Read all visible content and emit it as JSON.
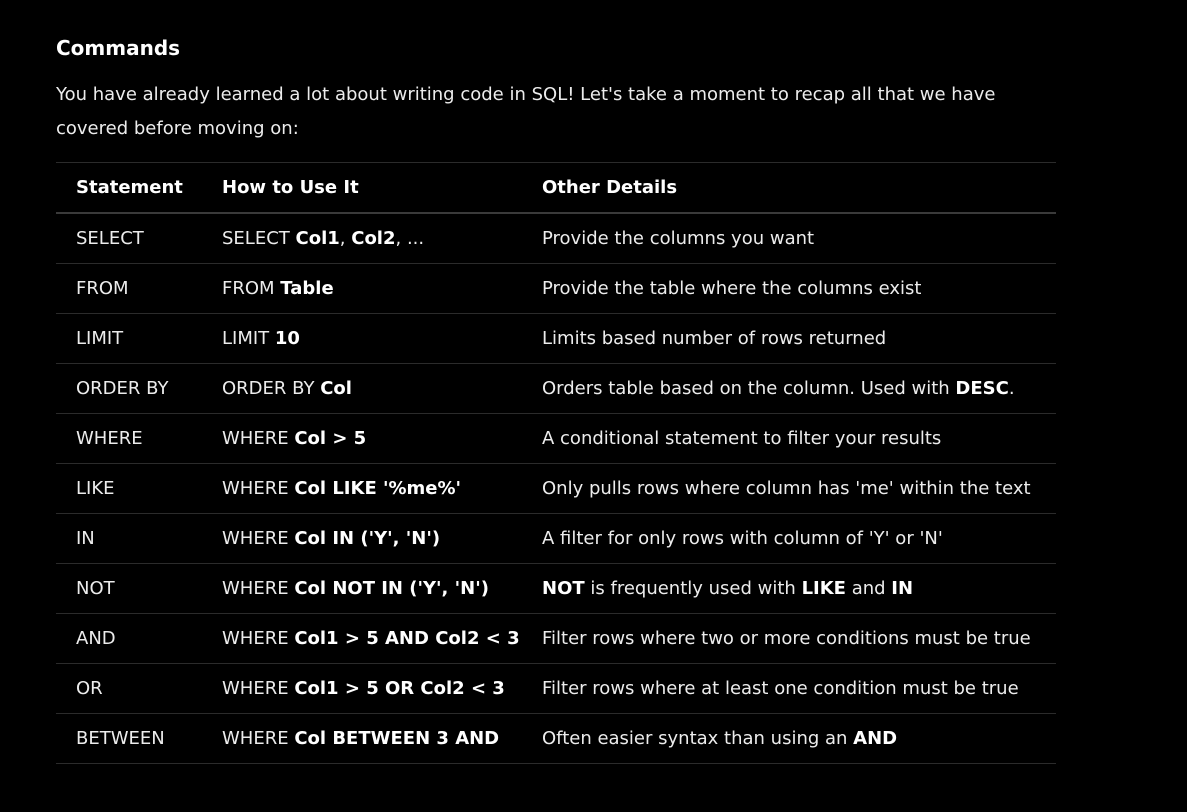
{
  "heading": "Commands",
  "intro": "You have already learned a lot about writing code in SQL! Let's take a moment to recap all that we have covered before moving on:",
  "table": {
    "headers": [
      "Statement",
      "How to Use It",
      "Other Details"
    ],
    "rows": [
      {
        "statement": "SELECT",
        "usage": [
          [
            "SELECT ",
            false
          ],
          [
            "Col1",
            true
          ],
          [
            ", ",
            false
          ],
          [
            "Col2",
            true
          ],
          [
            ", ...",
            false
          ]
        ],
        "details": [
          [
            "Provide the columns you want",
            false
          ]
        ]
      },
      {
        "statement": "FROM",
        "usage": [
          [
            "FROM ",
            false
          ],
          [
            "Table",
            true
          ]
        ],
        "details": [
          [
            "Provide the table where the columns exist",
            false
          ]
        ]
      },
      {
        "statement": "LIMIT",
        "usage": [
          [
            "LIMIT ",
            false
          ],
          [
            "10",
            true
          ]
        ],
        "details": [
          [
            "Limits based number of rows returned",
            false
          ]
        ]
      },
      {
        "statement": "ORDER BY",
        "usage": [
          [
            "ORDER BY ",
            false
          ],
          [
            "Col",
            true
          ]
        ],
        "details": [
          [
            "Orders table based on the column. Used with ",
            false
          ],
          [
            "DESC",
            true
          ],
          [
            ".",
            false
          ]
        ]
      },
      {
        "statement": "WHERE",
        "usage": [
          [
            "WHERE ",
            false
          ],
          [
            "Col > 5",
            true
          ]
        ],
        "details": [
          [
            "A conditional statement to filter your results",
            false
          ]
        ]
      },
      {
        "statement": "LIKE",
        "usage": [
          [
            "WHERE ",
            false
          ],
          [
            "Col LIKE '%me%'",
            true
          ]
        ],
        "details": [
          [
            "Only pulls rows where column has 'me' within the text",
            false
          ]
        ]
      },
      {
        "statement": "IN",
        "usage": [
          [
            "WHERE ",
            false
          ],
          [
            "Col IN ('Y', 'N')",
            true
          ]
        ],
        "details": [
          [
            "A filter for only rows with column of 'Y' or 'N'",
            false
          ]
        ]
      },
      {
        "statement": "NOT",
        "usage": [
          [
            "WHERE ",
            false
          ],
          [
            "Col NOT IN ('Y', 'N')",
            true
          ]
        ],
        "details": [
          [
            "NOT",
            true
          ],
          [
            " is frequently used with ",
            false
          ],
          [
            "LIKE",
            true
          ],
          [
            " and ",
            false
          ],
          [
            "IN",
            true
          ]
        ]
      },
      {
        "statement": "AND",
        "usage": [
          [
            "WHERE ",
            false
          ],
          [
            "Col1 > 5 AND Col2 < 3",
            true
          ]
        ],
        "details": [
          [
            "Filter rows where two or more conditions must be true",
            false
          ]
        ]
      },
      {
        "statement": "OR",
        "usage": [
          [
            "WHERE ",
            false
          ],
          [
            "Col1 > 5 OR Col2 < 3",
            true
          ]
        ],
        "details": [
          [
            "Filter rows where at least one condition must be true",
            false
          ]
        ]
      },
      {
        "statement": "BETWEEN",
        "usage": [
          [
            "WHERE ",
            false
          ],
          [
            "Col BETWEEN 3 AND",
            true
          ]
        ],
        "details": [
          [
            "Often easier syntax than using an ",
            false
          ],
          [
            "AND",
            true
          ]
        ]
      }
    ]
  }
}
